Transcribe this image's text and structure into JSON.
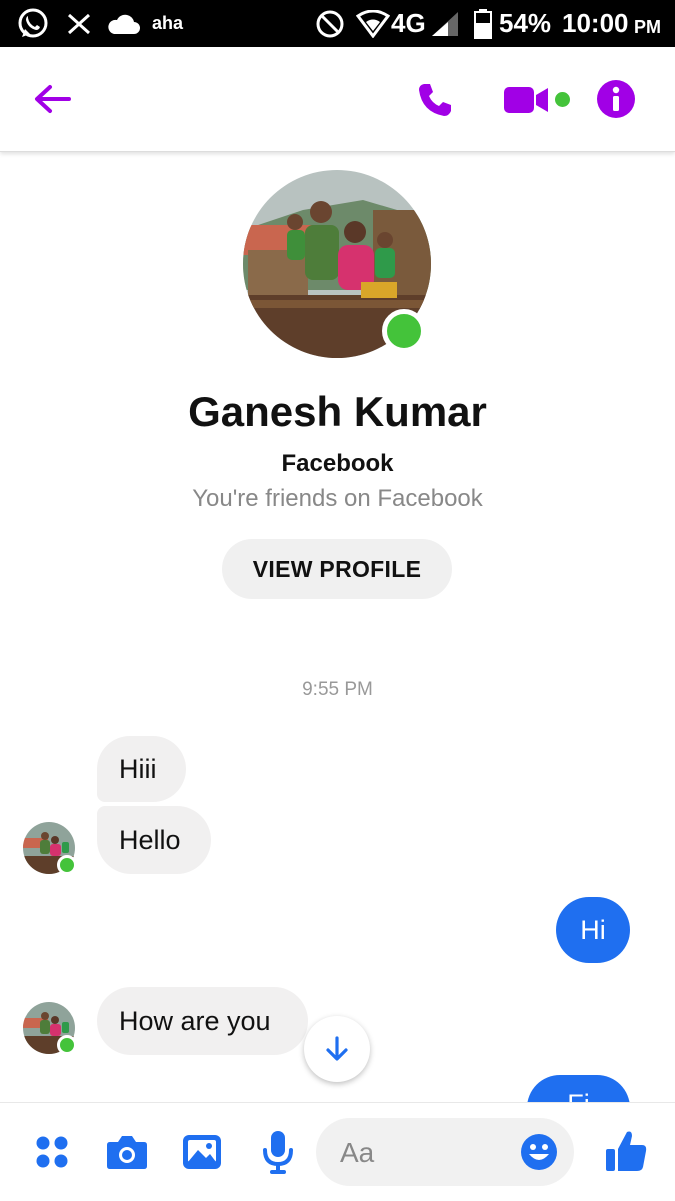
{
  "status_bar": {
    "carrier_app": "aha",
    "network": "4G",
    "battery": "54%",
    "time": "10:00",
    "ampm": "PM"
  },
  "header": {
    "icons": [
      "back-arrow-icon",
      "phone-icon",
      "video-camera-icon",
      "info-icon"
    ],
    "accent_color": "#a100e6"
  },
  "profile": {
    "name": "Ganesh Kumar",
    "source": "Facebook",
    "relationship": "You're friends on Facebook",
    "view_profile_label": "VIEW PROFILE"
  },
  "conversation": {
    "timestamp": "9:55 PM",
    "messages": [
      {
        "from": "them",
        "text": "Hiii"
      },
      {
        "from": "them",
        "text": "Hello"
      },
      {
        "from": "me",
        "text": "Hi"
      },
      {
        "from": "them",
        "text": "How are you"
      },
      {
        "from": "me",
        "text": "Fi"
      }
    ]
  },
  "composer": {
    "placeholder": "Aa",
    "icons": [
      "more-apps-icon",
      "camera-icon",
      "gallery-icon",
      "microphone-icon",
      "emoji-icon",
      "thumbs-up-icon"
    ],
    "accent_color": "#1f6ff0"
  }
}
